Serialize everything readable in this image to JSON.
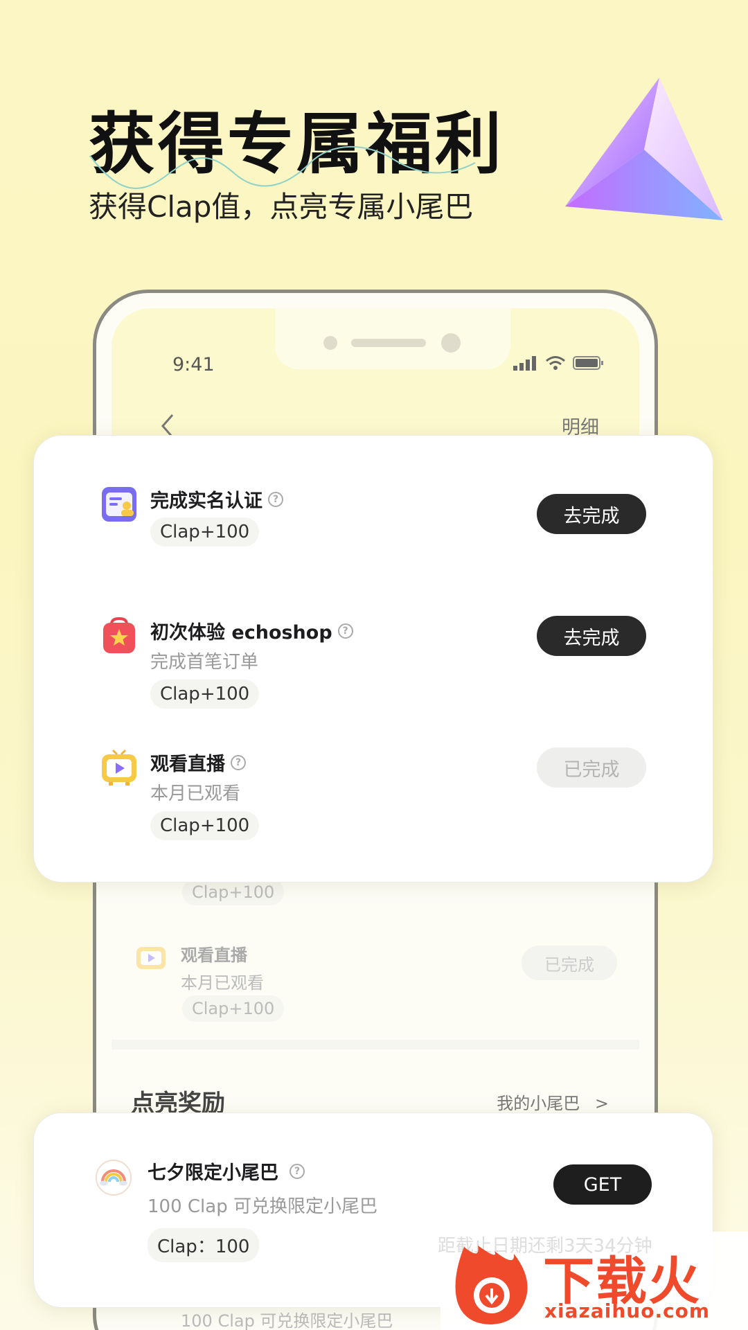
{
  "hero": {
    "title": "获得专属福利",
    "subtitle": "获得Clap值，点亮专属小尾巴"
  },
  "phone": {
    "status_time": "9:41",
    "nav_detail": "明细",
    "ghost_rows": {
      "chip_1": "Clap+100",
      "title": "观看直播",
      "desc": "本月已观看",
      "done": "已完成",
      "chip_2": "Clap+100"
    },
    "reward_section": {
      "title": "点亮奖励",
      "link": "我的小尾巴"
    },
    "ghost_bottom_text": "100 Clap 可兑换限定小尾巴"
  },
  "tasks": [
    {
      "title": "完成实名认证",
      "desc": "",
      "reward": "Clap+100",
      "button": "去完成",
      "status": "todo",
      "icon": "id-card-icon"
    },
    {
      "title": "初次体验 echoshop",
      "desc": "完成首笔订单",
      "reward": "Clap+100",
      "button": "去完成",
      "status": "todo",
      "icon": "shopping-bag-icon"
    },
    {
      "title": "观看直播",
      "desc": "本月已观看",
      "reward": "Clap+100",
      "button": "已完成",
      "status": "done",
      "icon": "live-tv-icon"
    }
  ],
  "reward": {
    "title": "七夕限定小尾巴",
    "desc": "100 Clap 可兑换限定小尾巴",
    "cost": "Clap：100",
    "button": "GET",
    "icon": "rainbow-icon"
  },
  "watermark": {
    "faint_text": "距截止日期还剩3天34分钟",
    "brand": "下载火",
    "domain": "xiazaihuo.com"
  },
  "colors": {
    "background": "#fbf6c4",
    "button_dark": "#2a2a2a",
    "watermark": "#ef4a2b"
  }
}
